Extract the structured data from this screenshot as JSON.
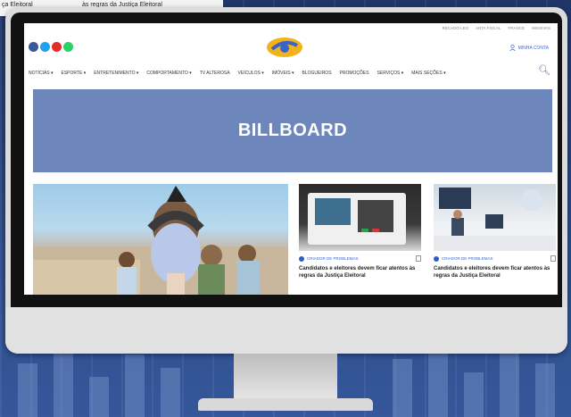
{
  "background": {
    "strip_left": "ça Eleitoral",
    "strip_right": "às regras da Justiça Eleitoral"
  },
  "site": {
    "top_links": [
      "RECADO LEO",
      "ANTA FISCAL",
      "FRANCE",
      "MISSIVAS"
    ],
    "social_icons": [
      {
        "name": "facebook-icon",
        "color": "#3b5998"
      },
      {
        "name": "twitter-icon",
        "color": "#1da1f2"
      },
      {
        "name": "youtube-icon",
        "color": "#e52d27"
      },
      {
        "name": "whatsapp-icon",
        "color": "#25d366"
      }
    ],
    "account_label": "MINHA CONTA",
    "nav": [
      "NOTÍCIAS ▾",
      "ESPORTE ▾",
      "ENTRETENIMENTO ▾",
      "COMPORTAMENTO ▾",
      "TV ALTEROSA",
      "VEÍCULOS ▾",
      "IMÓVEIS ▾",
      "BLOGUEIROS",
      "PROMOÇÕES",
      "SERVIÇOS ▾",
      "MAIS SEÇÕES ▾"
    ],
    "billboard": "BILLBOARD",
    "cards": [
      {
        "category": "CRIADOR DE PROBLEMAS",
        "headline": "Candidatos e eleitores devem ficar atentos às regras da Justiça Eleitoral"
      },
      {
        "category": "CRIADOR DE PROBLEMAS",
        "headline": "Candidatos e eleitores devem ficar atentos às regras da Justiça Eleitoral"
      }
    ]
  },
  "colors": {
    "accent": "#4a6bd1",
    "billboard": "#6d86bb",
    "background": "#2f4f8c"
  }
}
